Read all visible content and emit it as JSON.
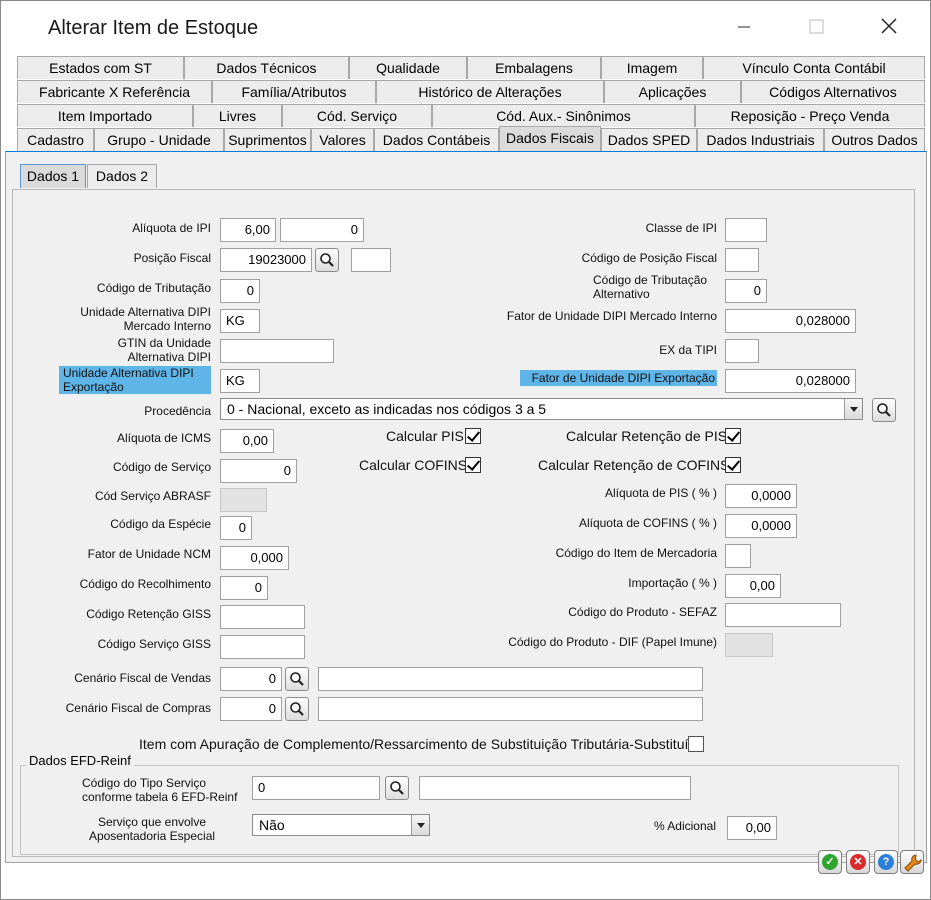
{
  "window": {
    "title": "Alterar Item de Estoque"
  },
  "tabs": {
    "row1": [
      "Estados com ST",
      "Dados Técnicos",
      "Qualidade",
      "Embalagens",
      "Imagem",
      "Vínculo Conta Contábil"
    ],
    "row2": [
      "Fabricante X Referência",
      "Família/Atributos",
      "Histórico de Alterações",
      "Aplicações",
      "Códigos Alternativos"
    ],
    "row3": [
      "Item Importado",
      "Livres",
      "Cód. Serviço",
      "Cód. Aux.- Sinônimos",
      "Reposição - Preço Venda"
    ],
    "row4": [
      "Cadastro",
      "Grupo - Unidade",
      "Suprimentos",
      "Valores",
      "Dados Contábeis",
      "Dados Fiscais",
      "Dados SPED",
      "Dados Industriais",
      "Outros Dados"
    ],
    "active": "Dados Fiscais"
  },
  "subtabs": [
    "Dados 1",
    "Dados 2"
  ],
  "left": {
    "aliquota_ipi": {
      "label": "Alíquota de IPI",
      "value": "6,00",
      "value2": "0"
    },
    "posicao_fiscal": {
      "label": "Posição Fiscal",
      "value": "19023000",
      "value2": ""
    },
    "codigo_tributacao": {
      "label": "Código de Tributação",
      "value": "0"
    },
    "unid_alt_dipi_mi": {
      "label1": "Unidade Alternativa DIPI",
      "label2": "Mercado Interno",
      "value": "KG"
    },
    "gtin": {
      "label1": "GTIN da Unidade",
      "label2": "Alternativa DIPI",
      "value": ""
    },
    "unid_alt_dipi_exp": {
      "label1": "Unidade Alternativa DIPI",
      "label2": "Exportação",
      "value": "KG"
    },
    "procedencia": {
      "label": "Procedência",
      "value": "0 - Nacional, exceto as indicadas nos códigos 3 a 5"
    },
    "aliquota_icms": {
      "label": "Alíquota de ICMS",
      "value": "0,00"
    },
    "codigo_servico": {
      "label": "Código de Serviço",
      "value": "0"
    },
    "cod_servico_abrasf": {
      "label": "Cód Serviço ABRASF",
      "value": ""
    },
    "codigo_especie": {
      "label": "Código da Espécie",
      "value": "0"
    },
    "fator_ncm": {
      "label": "Fator de Unidade NCM",
      "value": "0,000"
    },
    "codigo_recolhimento": {
      "label": "Código do Recolhimento",
      "value": "0"
    },
    "codigo_retencao_giss": {
      "label": "Código Retenção GISS",
      "value": ""
    },
    "codigo_servico_giss": {
      "label": "Código Serviço GISS",
      "value": ""
    },
    "cenario_vendas": {
      "label": "Cenário Fiscal de Vendas",
      "value": "0",
      "desc": ""
    },
    "cenario_compras": {
      "label": "Cenário Fiscal de Compras",
      "value": "0",
      "desc": ""
    }
  },
  "right": {
    "classe_ipi": {
      "label": "Classe de IPI",
      "value": ""
    },
    "codigo_posicao_fiscal": {
      "label": "Código de Posição Fiscal",
      "value": ""
    },
    "codigo_trib_alt": {
      "label1": "Código de Tributação",
      "label2": "Alternativo",
      "value": "0"
    },
    "fator_dipi_mi": {
      "label": "Fator de Unidade DIPI Mercado Interno",
      "value": "0,028000"
    },
    "ex_tipi": {
      "label": "EX da TIPI",
      "value": ""
    },
    "fator_dipi_exp": {
      "label": "Fator de Unidade DIPI Exportação",
      "value": "0,028000"
    },
    "retencao_pis": {
      "label": "Calcular Retenção de PIS",
      "checked": true
    },
    "retencao_cofins": {
      "label": "Calcular Retenção de COFINS",
      "checked": true
    },
    "aliquota_pis": {
      "label": "Alíquota de PIS  ( % )",
      "value": "0,0000"
    },
    "aliquota_cofins": {
      "label": "Alíquota de COFINS  ( % )",
      "value": "0,0000"
    },
    "codigo_item_mercadoria": {
      "label": "Código do Item de Mercadoria",
      "value": ""
    },
    "importacao": {
      "label": "Importação  ( % )",
      "value": "0,00"
    },
    "codigo_produto_sefaz": {
      "label": "Código do Produto - SEFAZ",
      "value": ""
    },
    "codigo_produto_dif": {
      "label": "Código do Produto - DIF (Papel Imune)",
      "value": ""
    }
  },
  "middle": {
    "calcular_pis": {
      "label": "Calcular PIS",
      "checked": true
    },
    "calcular_cofins": {
      "label": "Calcular COFINS",
      "checked": true
    }
  },
  "apuracao": {
    "label": "Item com Apuração de Complemento/Ressarcimento de Substituição Tributária-Substituído",
    "checked": false
  },
  "efd_reinf": {
    "title": "Dados EFD-Reinf",
    "tipo_servico": {
      "label1": "Código do Tipo Serviço",
      "label2": "conforme tabela 6 EFD-Reinf",
      "value": "0",
      "desc": ""
    },
    "aposentadoria": {
      "label1": "Serviço que envolve",
      "label2": "Aposentadoria Especial",
      "value": "Não"
    },
    "adicional": {
      "label": "% Adicional",
      "value": "0,00"
    }
  },
  "colors": {
    "highlight": "#5fb4e8",
    "ok": "#2fa52f",
    "cancel": "#d92b2b",
    "help": "#2b7fd9",
    "tool": "#e58a1a"
  }
}
